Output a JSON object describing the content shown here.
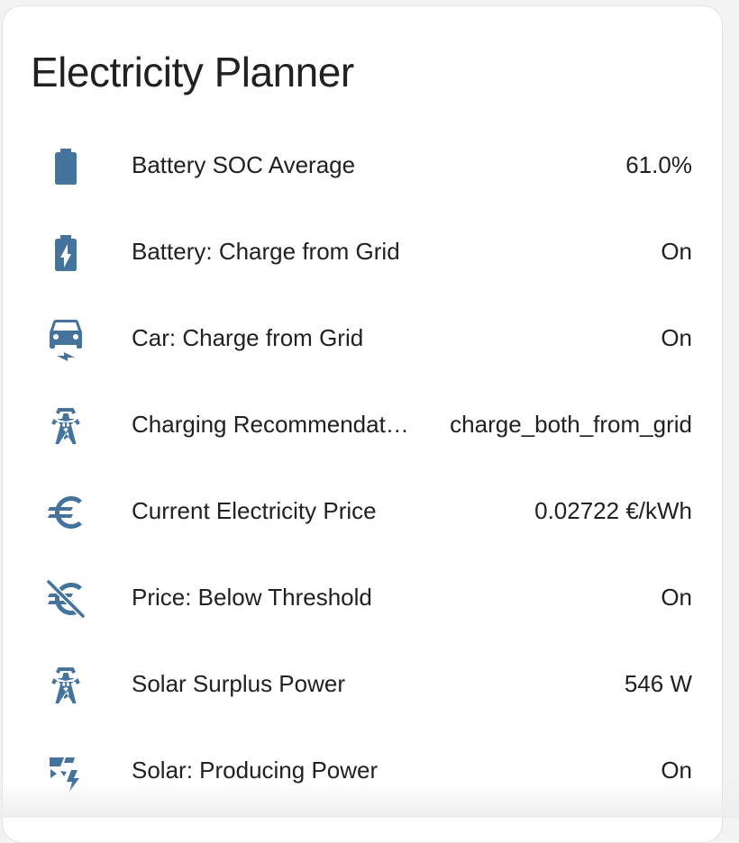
{
  "card": {
    "title": "Electricity Planner"
  },
  "colors": {
    "icon": "#44739e",
    "text": "#212121",
    "background": "#ffffff"
  },
  "rows": [
    {
      "icon": "battery-icon",
      "name": "Battery SOC Average",
      "value": "61.0%"
    },
    {
      "icon": "battery-charging-icon",
      "name": "Battery: Charge from Grid",
      "value": "On"
    },
    {
      "icon": "car-electric-icon",
      "name": "Car: Charge from Grid",
      "value": "On"
    },
    {
      "icon": "transmission-tower-icon",
      "name": "Charging Recommendat…",
      "value": "charge_both_from_grid"
    },
    {
      "icon": "euro-icon",
      "name": "Current Electricity Price",
      "value": "0.02722 €/kWh"
    },
    {
      "icon": "euro-off-icon",
      "name": "Price: Below Threshold",
      "value": "On"
    },
    {
      "icon": "transmission-tower-icon",
      "name": "Solar Surplus Power",
      "value": "546 W"
    },
    {
      "icon": "solar-power-icon",
      "name": "Solar: Producing Power",
      "value": "On"
    }
  ]
}
